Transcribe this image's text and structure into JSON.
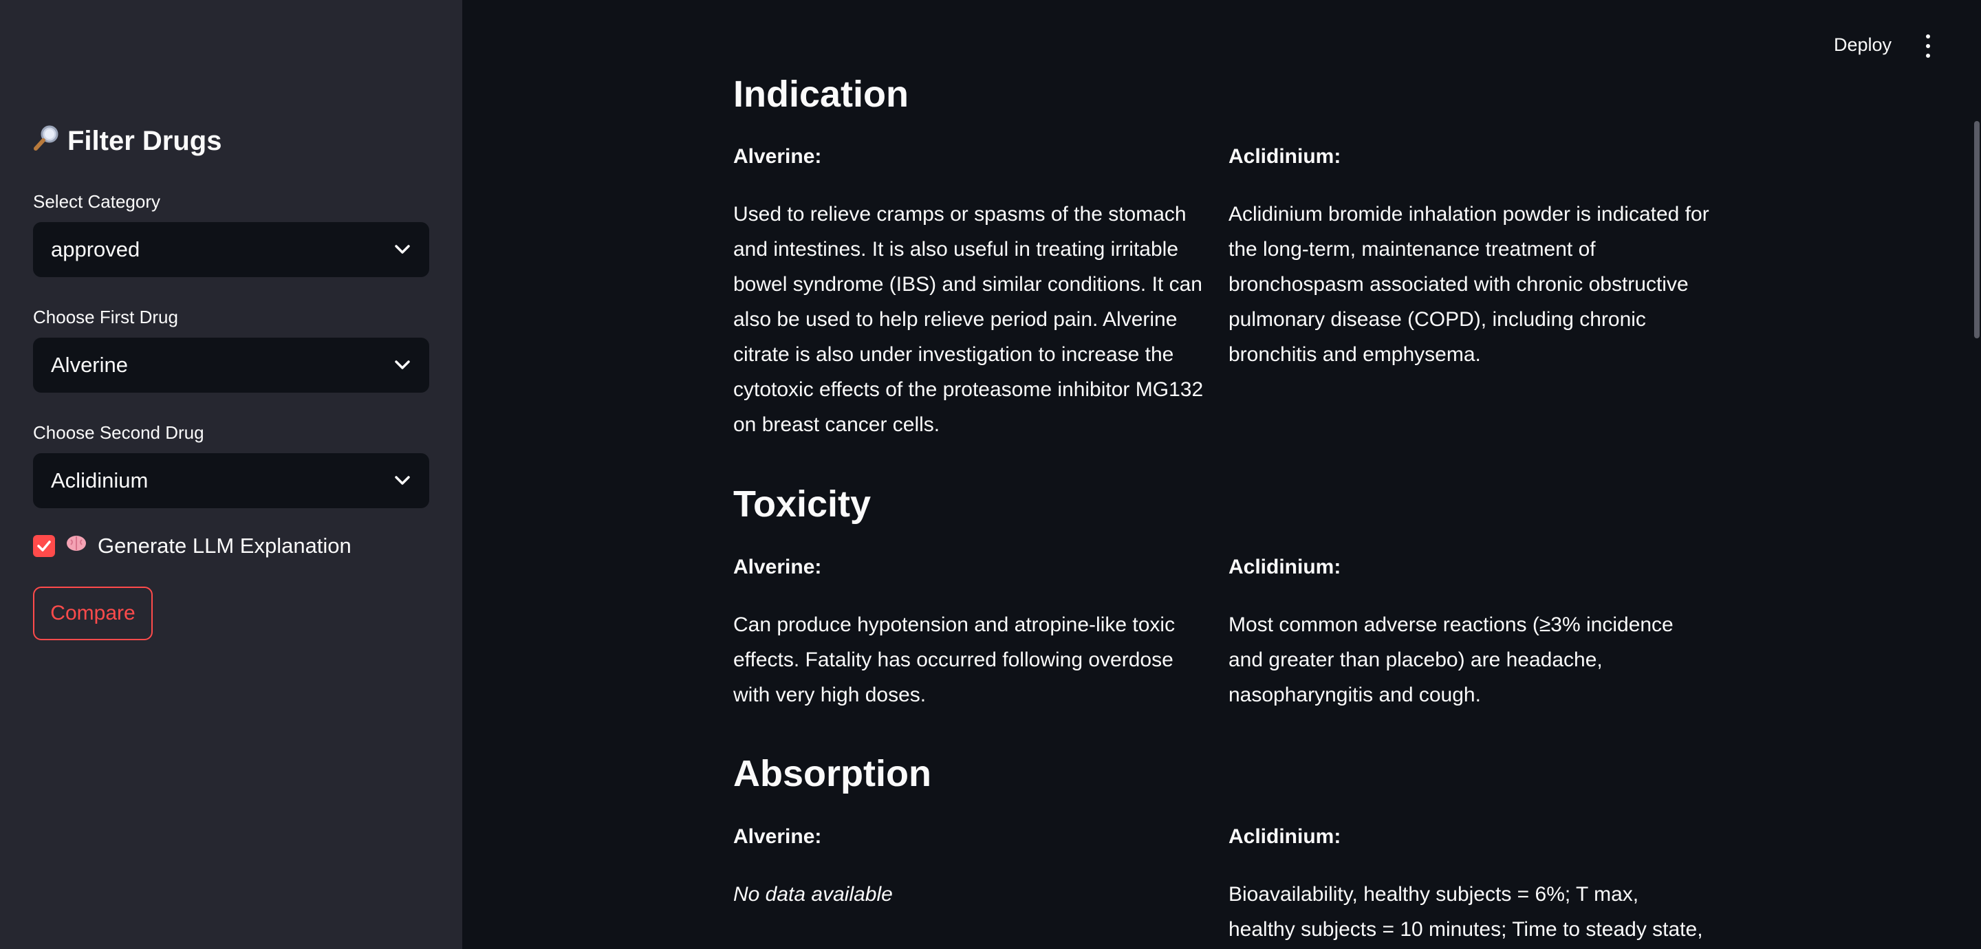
{
  "sidebar": {
    "title": "Filter Drugs",
    "title_icon": "magnifying-glass-icon",
    "category": {
      "label": "Select Category",
      "value": "approved"
    },
    "first_drug": {
      "label": "Choose First Drug",
      "value": "Alverine"
    },
    "second_drug": {
      "label": "Choose Second Drug",
      "value": "Aclidinium"
    },
    "llm_checkbox": {
      "label": "Generate LLM Explanation",
      "checked": true,
      "icon": "brain-icon"
    },
    "compare_button": "Compare",
    "accent_color": "#ff4b4b"
  },
  "header": {
    "deploy_label": "Deploy",
    "menu_icon": "kebab-menu-icon"
  },
  "sections": [
    {
      "title": "Indication",
      "left_head": "Alverine:",
      "left_text": "Used to relieve cramps or spasms of the stomach and intestines. It is also useful in treating irritable bowel syndrome (IBS) and similar conditions. It can also be used to help relieve period pain. Alverine citrate is also under investigation to increase the cytotoxic effects of the proteasome inhibitor MG132 on breast cancer cells.",
      "right_head": "Aclidinium:",
      "right_text": "Aclidinium bromide inhalation powder is indicated for the long-term, maintenance treatment of bronchospasm associated with chronic obstructive pulmonary disease (COPD), including chronic bronchitis and emphysema."
    },
    {
      "title": "Toxicity",
      "left_head": "Alverine:",
      "left_text": "Can produce hypotension and atropine-like toxic effects. Fatality has occurred following overdose with very high doses.",
      "right_head": "Aclidinium:",
      "right_text": "Most common adverse reactions (≥3% incidence and greater than placebo) are headache, nasopharyngitis and cough."
    },
    {
      "title": "Absorption",
      "left_head": "Alverine:",
      "left_text": "No data available",
      "right_head": "Aclidinium:",
      "right_text": "Bioavailability, healthy subjects = 6%; T max, healthy subjects = 10 minutes; Time to steady state,"
    }
  ]
}
